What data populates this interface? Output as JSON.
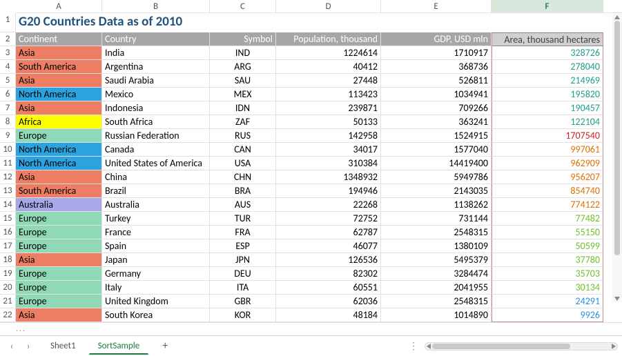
{
  "title": "G20 Countries Data as of 2010",
  "columns": {
    "letters": [
      "A",
      "B",
      "C",
      "D",
      "E",
      "F"
    ],
    "widths": [
      125,
      156,
      96,
      152,
      160,
      162
    ],
    "selected_index": 5
  },
  "headers": {
    "continent": "Continent",
    "country": "Country",
    "symbol": "Symbol",
    "population": "Population, thousand",
    "gdp": "GDP, USD mln",
    "area": "Area, thousand hectares"
  },
  "continent_colors": {
    "Asia": "#ed7d63",
    "South America": "#ed7d63",
    "North America": "#2aa3e0",
    "Africa": "#ffff00",
    "Europe": "#8fd9b6",
    "Australia": "#a8a8e8"
  },
  "area_colors": {
    "teal": "#1f9e8a",
    "red": "#d11f1f",
    "orange": "#e07000",
    "lime": "#6fbf2a",
    "blue": "#2a8fe0"
  },
  "chart_data": {
    "type": "table",
    "columns": [
      "Continent",
      "Country",
      "Symbol",
      "Population, thousand",
      "GDP, USD mln",
      "Area, thousand hectares"
    ],
    "rows": [
      {
        "continent": "Asia",
        "country": "India",
        "symbol": "IND",
        "population": 1224614,
        "gdp": 1710917,
        "area": 328726,
        "area_color": "teal"
      },
      {
        "continent": "South America",
        "country": "Argentina",
        "symbol": "ARG",
        "population": 40412,
        "gdp": 368736,
        "area": 278040,
        "area_color": "teal"
      },
      {
        "continent": "Asia",
        "country": "Saudi Arabia",
        "symbol": "SAU",
        "population": 27448,
        "gdp": 526811,
        "area": 214969,
        "area_color": "teal"
      },
      {
        "continent": "North America",
        "country": "Mexico",
        "symbol": "MEX",
        "population": 113423,
        "gdp": 1034941,
        "area": 195820,
        "area_color": "teal"
      },
      {
        "continent": "Asia",
        "country": "Indonesia",
        "symbol": "IDN",
        "population": 239871,
        "gdp": 709266,
        "area": 190457,
        "area_color": "teal"
      },
      {
        "continent": "Africa",
        "country": "South Africa",
        "symbol": "ZAF",
        "population": 50133,
        "gdp": 363241,
        "area": 122104,
        "area_color": "teal"
      },
      {
        "continent": "Europe",
        "country": "Russian Federation",
        "symbol": "RUS",
        "population": 142958,
        "gdp": 1524915,
        "area": 1707540,
        "area_color": "red"
      },
      {
        "continent": "North America",
        "country": "Canada",
        "symbol": "CAN",
        "population": 34017,
        "gdp": 1577040,
        "area": 997061,
        "area_color": "orange"
      },
      {
        "continent": "North America",
        "country": "United States of America",
        "symbol": "USA",
        "population": 310384,
        "gdp": 14419400,
        "area": 962909,
        "area_color": "orange"
      },
      {
        "continent": "Asia",
        "country": "China",
        "symbol": "CHN",
        "population": 1348932,
        "gdp": 5949786,
        "area": 956207,
        "area_color": "orange"
      },
      {
        "continent": "South America",
        "country": "Brazil",
        "symbol": "BRA",
        "population": 194946,
        "gdp": 2143035,
        "area": 854740,
        "area_color": "orange"
      },
      {
        "continent": "Australia",
        "country": "Australia",
        "symbol": "AUS",
        "population": 22268,
        "gdp": 1138262,
        "area": 774122,
        "area_color": "orange"
      },
      {
        "continent": "Europe",
        "country": "Turkey",
        "symbol": "TUR",
        "population": 72752,
        "gdp": 731144,
        "area": 77482,
        "area_color": "lime"
      },
      {
        "continent": "Europe",
        "country": "France",
        "symbol": "FRA",
        "population": 62787,
        "gdp": 2548315,
        "area": 55150,
        "area_color": "lime"
      },
      {
        "continent": "Europe",
        "country": "Spain",
        "symbol": "ESP",
        "population": 46077,
        "gdp": 1380109,
        "area": 50599,
        "area_color": "lime"
      },
      {
        "continent": "Asia",
        "country": "Japan",
        "symbol": "JPN",
        "population": 126536,
        "gdp": 5495379,
        "area": 37780,
        "area_color": "lime"
      },
      {
        "continent": "Europe",
        "country": "Germany",
        "symbol": "DEU",
        "population": 82302,
        "gdp": 3284474,
        "area": 35703,
        "area_color": "lime"
      },
      {
        "continent": "Europe",
        "country": "Italy",
        "symbol": "ITA",
        "population": 60551,
        "gdp": 2041955,
        "area": 30134,
        "area_color": "lime"
      },
      {
        "continent": "Europe",
        "country": "United Kingdom",
        "symbol": "GBR",
        "population": 62036,
        "gdp": 2548315,
        "area": 24291,
        "area_color": "blue"
      },
      {
        "continent": "Asia",
        "country": "South Korea",
        "symbol": "KOR",
        "population": 48184,
        "gdp": 1014890,
        "area": 9926,
        "area_color": "blue"
      }
    ]
  },
  "tabs": {
    "sheets": [
      "Sheet1",
      "SortSample"
    ],
    "active_index": 1
  },
  "nav": {
    "prev": "‹",
    "next": "›"
  },
  "ellipsis": "..."
}
